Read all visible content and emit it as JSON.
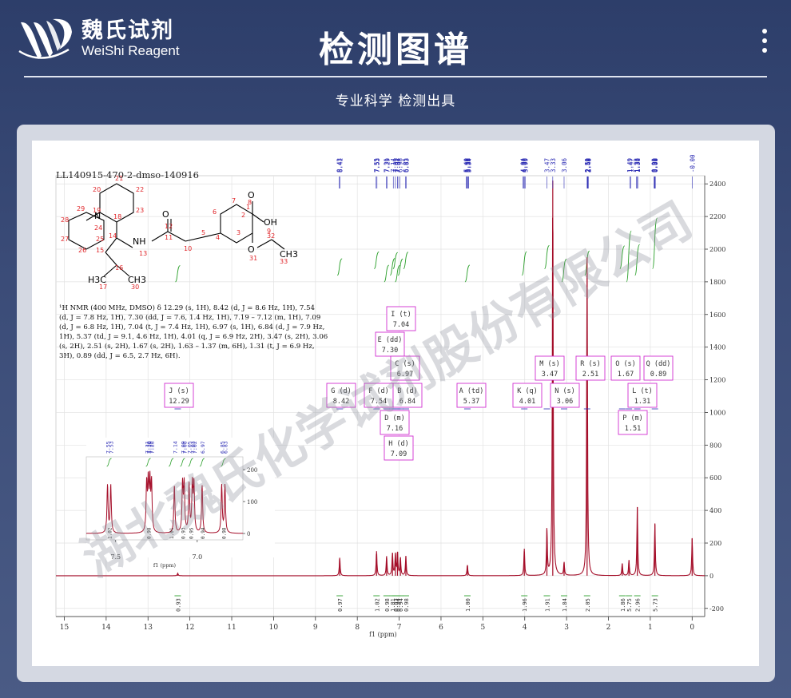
{
  "header": {
    "logo_cn": "魏氏试剂",
    "logo_en": "WeiShi Reagent",
    "title": "检测图谱",
    "subtitle": "专业科学  检测出具"
  },
  "watermark": "湖北魏氏化学试剂股份有限公司",
  "spectrum": {
    "sample_id": "LL140915-470-2-dmso-140916",
    "nmr_text": [
      "¹H NMR (400 MHz, DMSO) δ 12.29 (s, 1H), 8.42 (d, J = 8.6 Hz, 1H), 7.54",
      "(d, J = 7.8 Hz, 1H), 7.30 (dd, J = 7.6, 1.4 Hz, 1H), 7.19 – 7.12 (m, 1H), 7.09",
      "(d, J = 6.8 Hz, 1H), 7.04 (t, J = 7.4 Hz, 1H), 6.97 (s, 1H), 6.84 (d, J = 7.9 Hz,",
      "1H), 5.37 (td, J = 9.1, 4.6 Hz, 1H), 4.01 (q, J = 6.9 Hz, 2H), 3.47 (s, 2H), 3.06",
      "(s, 2H), 2.51 (s, 2H), 1.67 (s, 2H), 1.63 – 1.37 (m, 6H), 1.31 (t, J = 6.9 Hz,",
      "3H), 0.89 (dd, J = 6.5, 2.7 Hz, 6H)."
    ],
    "atom_labels": [
      "20",
      "21",
      "22",
      "19",
      "18",
      "23",
      "29",
      "28",
      "N",
      "24",
      "27",
      "25",
      "26",
      "14",
      "15",
      "16",
      "17",
      "30",
      "13",
      "NH",
      "11",
      "12",
      "O",
      "10",
      "5",
      "6",
      "7",
      "4",
      "3",
      "2",
      "1",
      "8",
      "O",
      "OH",
      "9",
      "31",
      "O",
      "32",
      "33",
      "CH3",
      "H3C",
      "CH3"
    ]
  },
  "chart_data": {
    "type": "line",
    "title": "",
    "xlabel": "f1 (ppm)",
    "ylabel": "",
    "xlim": [
      15.2,
      -0.3
    ],
    "ylim": [
      -250,
      2450
    ],
    "x_ticks": [
      "15",
      "14",
      "13",
      "12",
      "11",
      "10",
      "9",
      "8",
      "7",
      "6",
      "5",
      "4",
      "3",
      "2",
      "1",
      "0"
    ],
    "y_ticks": [
      "-200",
      "0",
      "200",
      "400",
      "600",
      "800",
      "1000",
      "1200",
      "1400",
      "1600",
      "1800",
      "2000",
      "2200",
      "2400"
    ],
    "peaks": [
      {
        "ppm": 12.29,
        "h": 15
      },
      {
        "ppm": 8.42,
        "h": 110
      },
      {
        "ppm": 7.54,
        "h": 150
      },
      {
        "ppm": 7.3,
        "h": 120
      },
      {
        "ppm": 7.16,
        "h": 140
      },
      {
        "ppm": 7.09,
        "h": 130
      },
      {
        "ppm": 7.04,
        "h": 145
      },
      {
        "ppm": 6.97,
        "h": 110
      },
      {
        "ppm": 6.84,
        "h": 120
      },
      {
        "ppm": 5.37,
        "h": 65
      },
      {
        "ppm": 4.01,
        "h": 165
      },
      {
        "ppm": 3.47,
        "h": 280
      },
      {
        "ppm": 3.33,
        "h": 2420
      },
      {
        "ppm": 3.06,
        "h": 80
      },
      {
        "ppm": 2.51,
        "h": 1950
      },
      {
        "ppm": 1.67,
        "h": 75
      },
      {
        "ppm": 1.51,
        "h": 95
      },
      {
        "ppm": 1.31,
        "h": 420
      },
      {
        "ppm": 0.89,
        "h": 320
      },
      {
        "ppm": 0.0,
        "h": 230
      }
    ],
    "peak_labels": [
      "8.43",
      "8.41",
      "7.55",
      "7.53",
      "7.31",
      "7.29",
      "7.14",
      "7.09",
      "7.04",
      "7.03",
      "6.98",
      "6.85",
      "6.83",
      "5.40",
      "5.38",
      "5.37",
      "5.35",
      "5.34",
      "4.04",
      "4.02",
      "4.00",
      "3.99",
      "3.47",
      "3.33",
      "3.06",
      "2.51",
      "2.50",
      "2.50",
      "2.49",
      "2.48",
      "1.49",
      "1.47",
      "1.33",
      "1.31",
      "1.30",
      "0.91",
      "0.90",
      "0.89",
      "0.88",
      "-0.00"
    ],
    "multiplets": [
      {
        "name": "I (t)",
        "shift": "7.04"
      },
      {
        "name": "E (dd)",
        "shift": "7.30"
      },
      {
        "name": "C (s)",
        "shift": "6.97"
      },
      {
        "name": "M (s)",
        "shift": "3.47"
      },
      {
        "name": "R (s)",
        "shift": "2.51"
      },
      {
        "name": "O (s)",
        "shift": "1.67"
      },
      {
        "name": "Q (dd)",
        "shift": "0.89"
      },
      {
        "name": "J (s)",
        "shift": "12.29"
      },
      {
        "name": "G (d)",
        "shift": "8.42"
      },
      {
        "name": "F (d)",
        "shift": "7.54"
      },
      {
        "name": "B (d)",
        "shift": "6.84"
      },
      {
        "name": "A (td)",
        "shift": "5.37"
      },
      {
        "name": "K (q)",
        "shift": "4.01"
      },
      {
        "name": "N (s)",
        "shift": "3.06"
      },
      {
        "name": "L (t)",
        "shift": "1.31"
      },
      {
        "name": "D (m)",
        "shift": "7.16"
      },
      {
        "name": "H (d)",
        "shift": "7.09"
      },
      {
        "name": "P (m)",
        "shift": "1.51"
      }
    ],
    "integrals": [
      {
        "ppm": 12.29,
        "value": "0.93"
      },
      {
        "ppm": 8.42,
        "value": "0.97"
      },
      {
        "ppm": 7.54,
        "value": "1.02"
      },
      {
        "ppm": 7.3,
        "value": "0.98"
      },
      {
        "ppm": 7.16,
        "value": "1.01"
      },
      {
        "ppm": 7.09,
        "value": "0.93"
      },
      {
        "ppm": 7.04,
        "value": "0.94"
      },
      {
        "ppm": 6.97,
        "value": "0.94"
      },
      {
        "ppm": 6.84,
        "value": "0.98"
      },
      {
        "ppm": 5.37,
        "value": "1.00"
      },
      {
        "ppm": 4.01,
        "value": "1.96"
      },
      {
        "ppm": 3.47,
        "value": "1.91"
      },
      {
        "ppm": 3.06,
        "value": "1.84"
      },
      {
        "ppm": 2.51,
        "value": "2.05"
      },
      {
        "ppm": 1.67,
        "value": "1.86"
      },
      {
        "ppm": 1.51,
        "value": "5.75"
      },
      {
        "ppm": 1.31,
        "value": "2.96"
      },
      {
        "ppm": 0.89,
        "value": "5.73"
      }
    ],
    "inset": {
      "xlim": [
        7.68,
        6.72
      ],
      "x_ticks": [
        "7.5",
        "7.0"
      ],
      "y_ticks": [
        "0",
        "100",
        "200"
      ],
      "xlabel": "f1 (ppm)",
      "peak_labels": [
        "7.55",
        "7.53",
        "7.31",
        "7.30",
        "7.29",
        "7.28",
        "7.14",
        "7.09",
        "7.08",
        "7.05",
        "7.03",
        "7.02",
        "6.97",
        "6.85",
        "6.83"
      ],
      "integrals": [
        "1.02",
        "0.98",
        "1.01",
        "0.93",
        "0.95",
        "0.94",
        "0.98"
      ]
    },
    "colors": {
      "spectrum": "#a50f2a",
      "integral": "#2ca02c",
      "label": "#2d2db4",
      "multiplet": "#d12fd1"
    }
  }
}
